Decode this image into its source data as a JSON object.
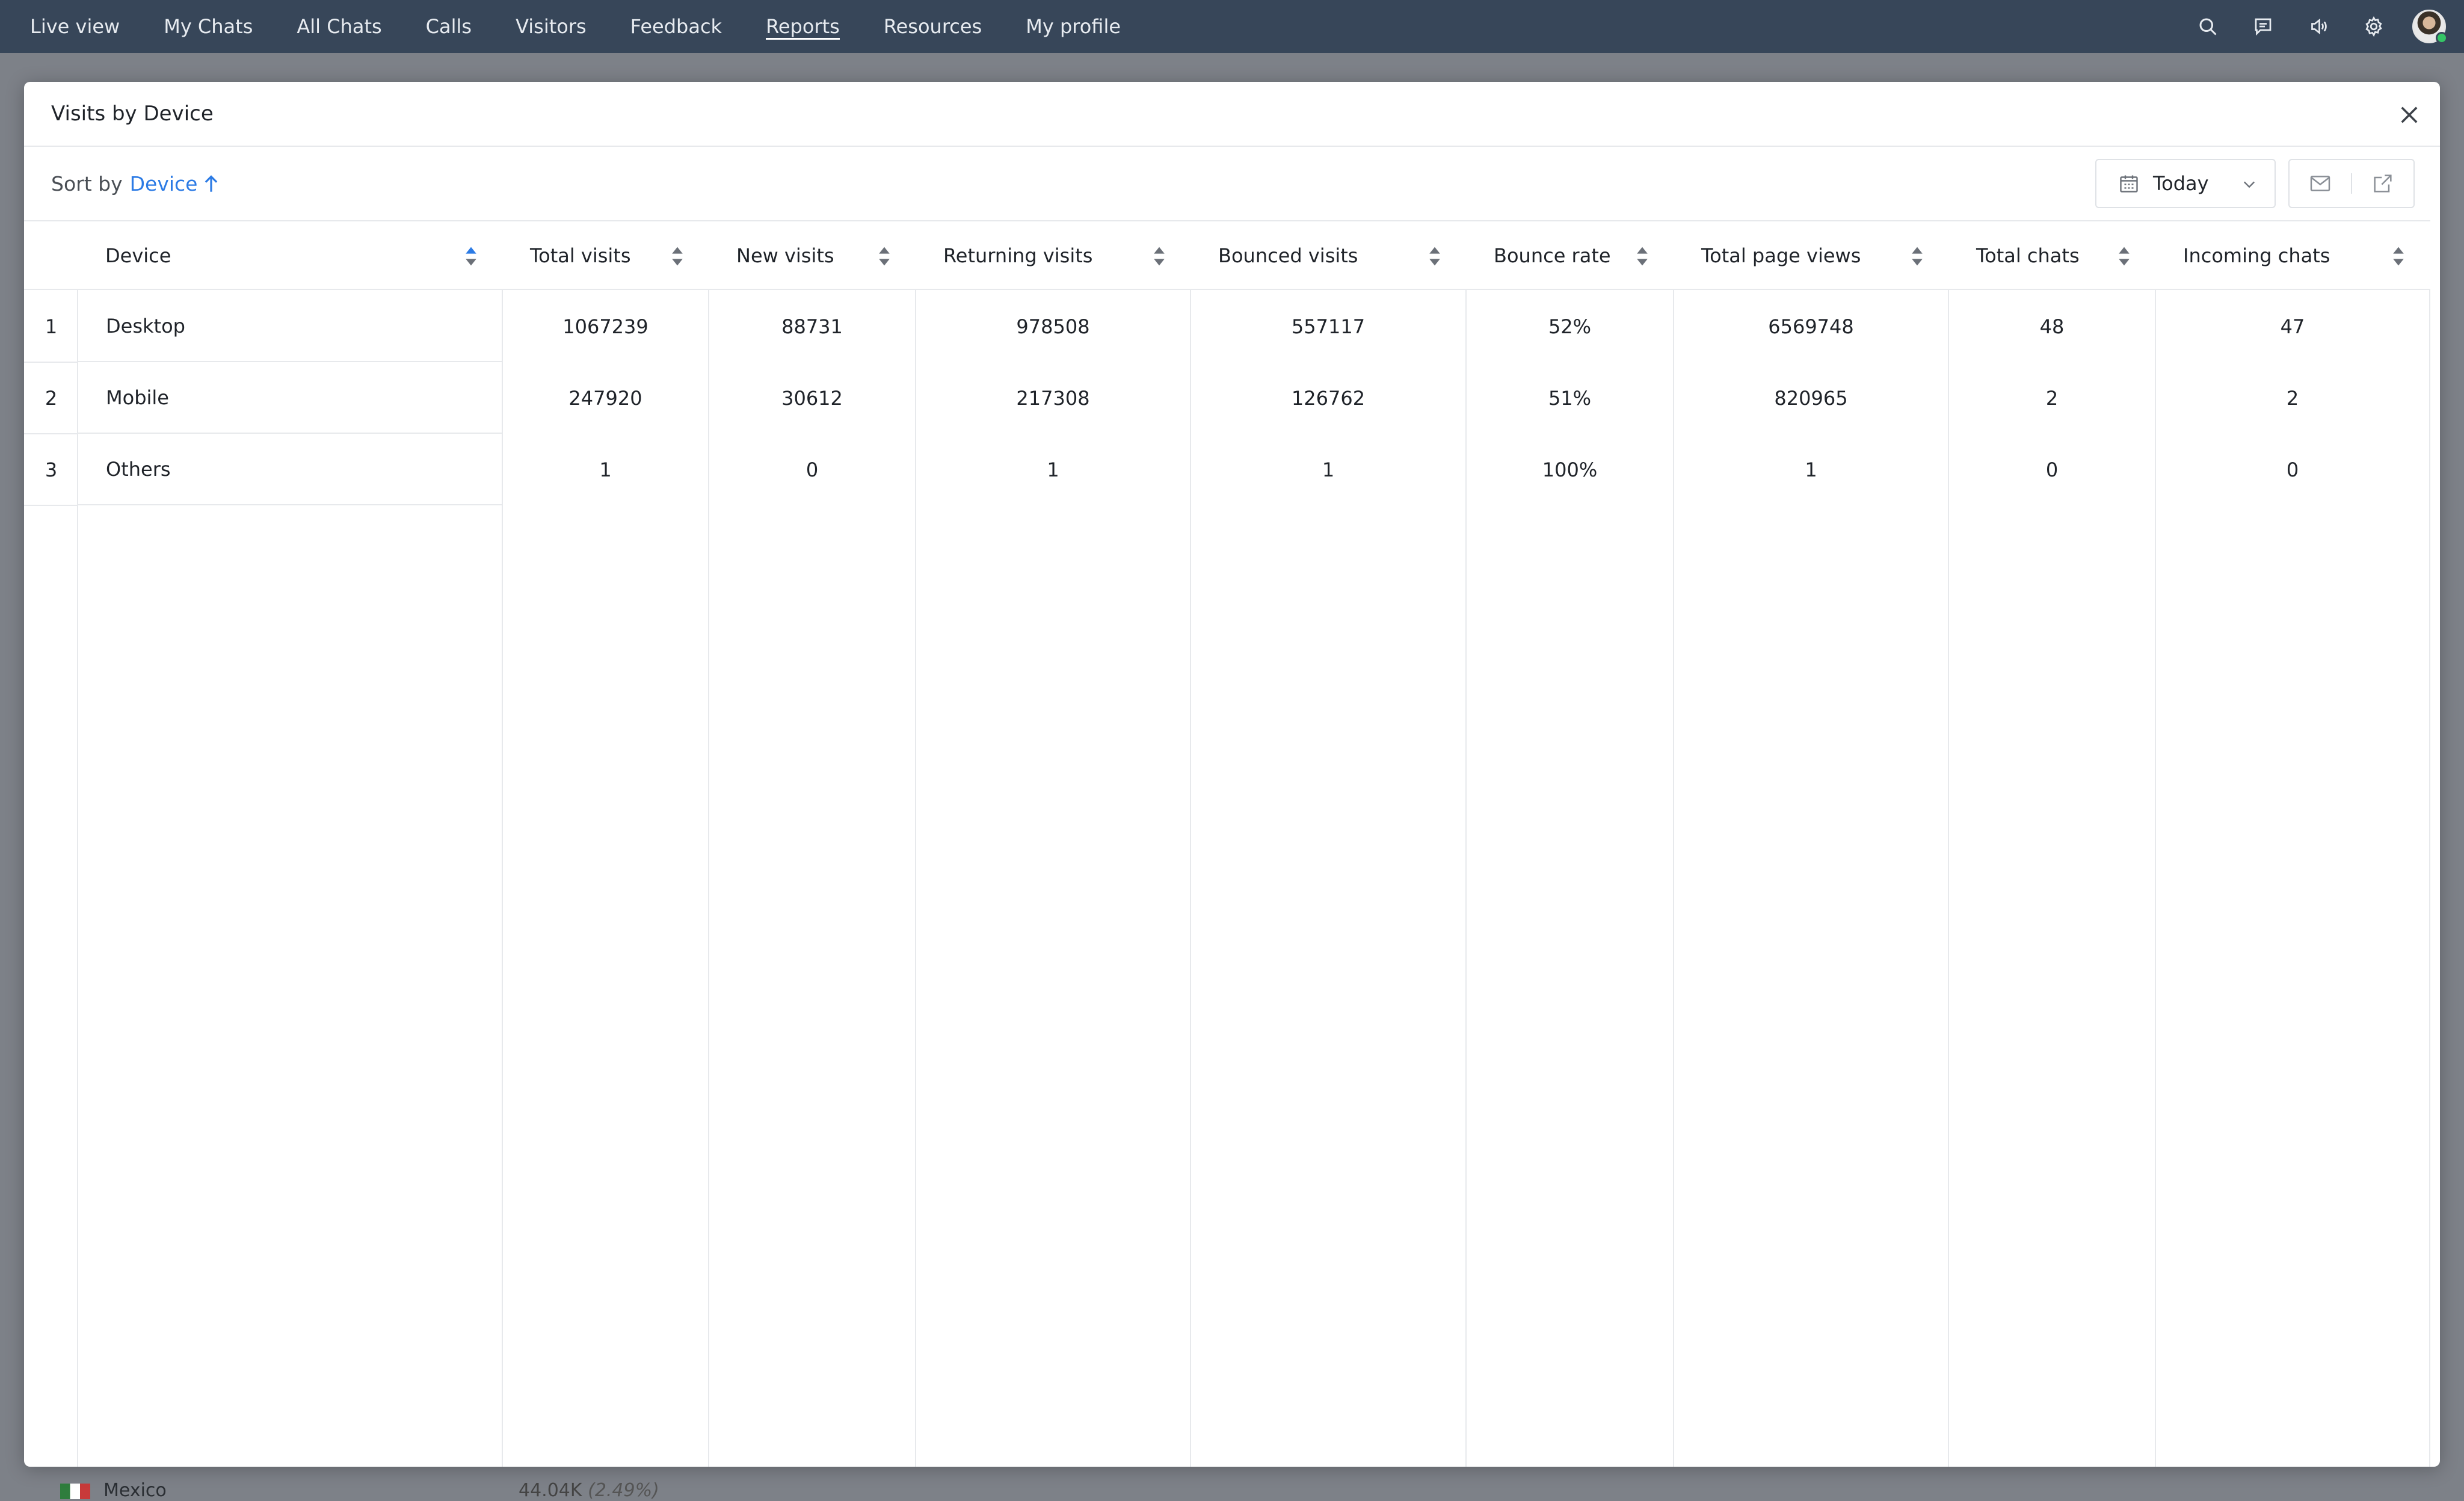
{
  "nav": {
    "tabs": [
      {
        "label": "Live view"
      },
      {
        "label": "My Chats"
      },
      {
        "label": "All Chats"
      },
      {
        "label": "Calls"
      },
      {
        "label": "Visitors"
      },
      {
        "label": "Feedback"
      },
      {
        "label": "Reports",
        "active": true
      },
      {
        "label": "Resources"
      },
      {
        "label": "My profile"
      }
    ],
    "icons": [
      "search-icon",
      "chat-bubble-icon",
      "speaker-icon",
      "gear-icon"
    ]
  },
  "background": {
    "country": "Mexico",
    "value": "44.04K",
    "percent": "(2.49%)"
  },
  "modal": {
    "title": "Visits by Device",
    "sort_label": "Sort by",
    "sort_value": "Device",
    "date_range": "Today"
  },
  "table": {
    "columns": [
      "Device",
      "Total visits",
      "New visits",
      "Returning visits",
      "Bounced visits",
      "Bounce rate",
      "Total page views",
      "Total chats",
      "Incoming chats"
    ],
    "rows": [
      {
        "num": "1",
        "device": "Desktop",
        "values": [
          "1067239",
          "88731",
          "978508",
          "557117",
          "52%",
          "6569748",
          "48",
          "47"
        ]
      },
      {
        "num": "2",
        "device": "Mobile",
        "values": [
          "247920",
          "30612",
          "217308",
          "126762",
          "51%",
          "820965",
          "2",
          "2"
        ]
      },
      {
        "num": "3",
        "device": "Others",
        "values": [
          "1",
          "0",
          "1",
          "1",
          "100%",
          "1",
          "0",
          "0"
        ]
      }
    ]
  },
  "colors": {
    "nav_bg": "#374659",
    "accent": "#2c7be5",
    "online": "#35c566"
  }
}
